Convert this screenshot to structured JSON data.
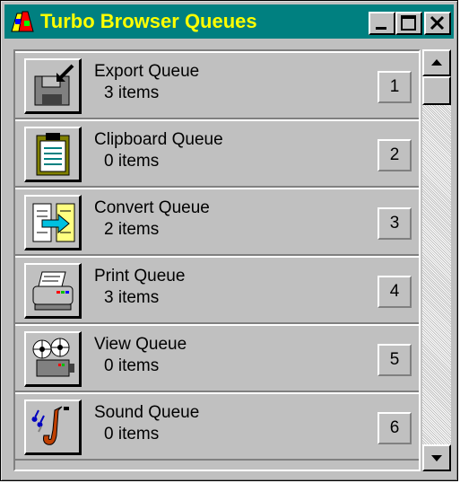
{
  "window": {
    "title": "Turbo Browser Queues",
    "title_color": "#ffff00",
    "titlebar_color": "#008080",
    "controls": [
      "minimize-icon",
      "maximize-icon",
      "close-icon"
    ]
  },
  "queues": [
    {
      "name": "Export Queue",
      "count": "3 items",
      "number": "1",
      "icon": "export-disk-icon"
    },
    {
      "name": "Clipboard Queue",
      "count": "0 items",
      "number": "2",
      "icon": "clipboard-icon"
    },
    {
      "name": "Convert Queue",
      "count": "2 items",
      "number": "3",
      "icon": "convert-document-icon"
    },
    {
      "name": "Print Queue",
      "count": "3 items",
      "number": "4",
      "icon": "printer-icon"
    },
    {
      "name": "View Queue",
      "count": "0 items",
      "number": "5",
      "icon": "film-projector-icon"
    },
    {
      "name": "Sound Queue",
      "count": "0 items",
      "number": "6",
      "icon": "saxophone-icon"
    }
  ],
  "scrollbar": {
    "up": "scroll-up-arrow-icon",
    "down": "scroll-down-arrow-icon"
  }
}
